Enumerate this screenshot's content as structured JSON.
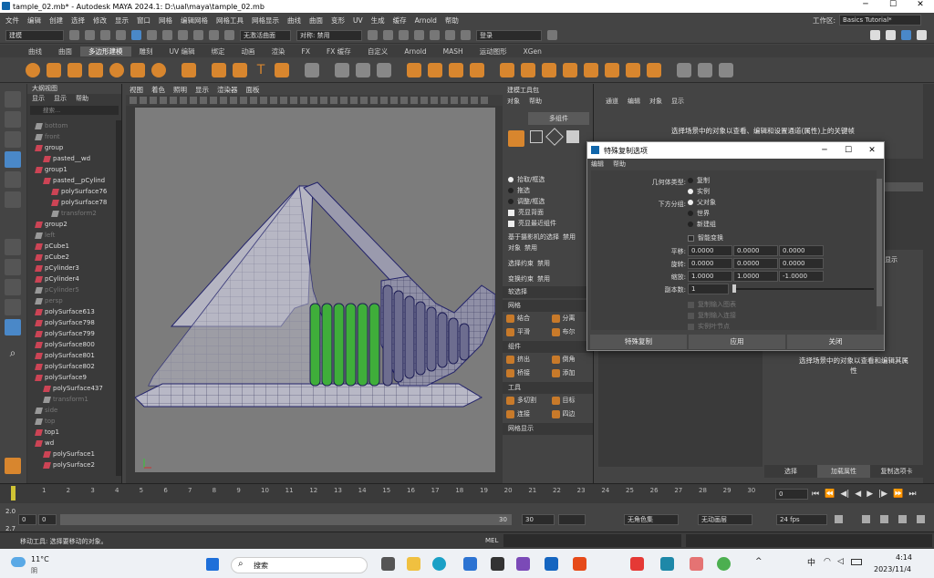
{
  "window": {
    "title": "tample_02.mb* - Autodesk MAYA 2024.1: D:\\ual\\maya\\tample_02.mb"
  },
  "menubar": {
    "items": [
      "文件",
      "编辑",
      "创建",
      "选择",
      "修改",
      "显示",
      "窗口",
      "网格",
      "编辑网格",
      "网格工具",
      "网格显示",
      "曲线",
      "曲面",
      "变形",
      "UV",
      "生成",
      "缓存",
      "Arnold",
      "帮助"
    ],
    "workspace_label": "工作区:",
    "workspace_value": "Basics Tutorial*"
  },
  "statusline": {
    "mode": "建模",
    "live_surface": "无激活曲面",
    "symmetry": "对称: 禁用",
    "login": "登录"
  },
  "shelf": {
    "tabs": [
      "曲线",
      "曲面",
      "多边形建模",
      "雕刻",
      "UV 编辑",
      "绑定",
      "动画",
      "渲染",
      "FX",
      "FX 缓存",
      "自定义",
      "Arnold",
      "MASH",
      "运动图形",
      "XGen"
    ],
    "active_tab": 2
  },
  "outliner": {
    "title": "大纲视图",
    "menu": [
      "显示",
      "显示",
      "帮助"
    ],
    "search_placeholder": "搜索...",
    "items": [
      {
        "label": "bottom",
        "dim": true,
        "indent": 1
      },
      {
        "label": "front",
        "dim": true,
        "indent": 1
      },
      {
        "label": "group",
        "dim": false,
        "indent": 1
      },
      {
        "label": "pasted__wd",
        "dim": false,
        "indent": 2
      },
      {
        "label": "group1",
        "dim": false,
        "indent": 1
      },
      {
        "label": "pasted__pCylind",
        "dim": false,
        "indent": 2
      },
      {
        "label": "polySurface76",
        "dim": false,
        "indent": 3
      },
      {
        "label": "polySurface78",
        "dim": false,
        "indent": 3
      },
      {
        "label": "transform2",
        "dim": true,
        "indent": 3
      },
      {
        "label": "group2",
        "dim": false,
        "indent": 1
      },
      {
        "label": "left",
        "dim": true,
        "indent": 1
      },
      {
        "label": "pCube1",
        "dim": false,
        "indent": 1
      },
      {
        "label": "pCube2",
        "dim": false,
        "indent": 1
      },
      {
        "label": "pCylinder3",
        "dim": false,
        "indent": 1
      },
      {
        "label": "pCylinder4",
        "dim": false,
        "indent": 1
      },
      {
        "label": "pCylinder5",
        "dim": true,
        "indent": 1
      },
      {
        "label": "persp",
        "dim": true,
        "indent": 1
      },
      {
        "label": "polySurface613",
        "dim": false,
        "indent": 1
      },
      {
        "label": "polySurface798",
        "dim": false,
        "indent": 1
      },
      {
        "label": "polySurface799",
        "dim": false,
        "indent": 1
      },
      {
        "label": "polySurface800",
        "dim": false,
        "indent": 1
      },
      {
        "label": "polySurface801",
        "dim": false,
        "indent": 1
      },
      {
        "label": "polySurface802",
        "dim": false,
        "indent": 1
      },
      {
        "label": "polySurface9",
        "dim": false,
        "indent": 1
      },
      {
        "label": "polySurface437",
        "dim": false,
        "indent": 2
      },
      {
        "label": "transform1",
        "dim": true,
        "indent": 2
      },
      {
        "label": "side",
        "dim": true,
        "indent": 1
      },
      {
        "label": "top",
        "dim": true,
        "indent": 1
      },
      {
        "label": "top1",
        "dim": false,
        "indent": 1
      },
      {
        "label": "wd",
        "dim": false,
        "indent": 1
      },
      {
        "label": "polySurface1",
        "dim": false,
        "indent": 2
      },
      {
        "label": "polySurface2",
        "dim": false,
        "indent": 2
      }
    ]
  },
  "viewport": {
    "menu": [
      "视图",
      "着色",
      "照明",
      "显示",
      "渲染器",
      "面板"
    ]
  },
  "modeling": {
    "title": "建模工具包",
    "menu": [
      "对象",
      "帮助"
    ],
    "multi": "多组件",
    "radios": [
      {
        "label": "拾取/框选",
        "on": true
      },
      {
        "label": "拖选",
        "on": false
      },
      {
        "label": "调整/框选",
        "on": false
      }
    ],
    "checks": [
      "亮显背面",
      "亮显最近组件"
    ],
    "sel_based": "基于摄影机的选择",
    "disabled": "禁用",
    "object": "对象",
    "constraint": "选择约束",
    "transform_constraint": "变换约束",
    "soft": "软选择",
    "mesh": "网格",
    "combine": "结合",
    "separate": "分离",
    "smooth": "平滑",
    "boolean": "布尔",
    "components": "组件",
    "extrude": "挤出",
    "bevel": "倒角",
    "bridge": "桥接",
    "add_div": "添加",
    "tools": "工具",
    "multicut": "多切割",
    "target": "目标",
    "connect": "连接",
    "quad": "四边",
    "more": "网格显示"
  },
  "channel": {
    "menu": [
      "通道",
      "编辑",
      "对象",
      "显示"
    ],
    "msg": "选择场景中的对象以查看、编辑和设置通道(属性)上的关键帧",
    "msg2": "选择场景中的对象以查看和编辑其属性",
    "tabs": [
      "选择",
      "加载属性",
      "复制选项卡"
    ],
    "show": "显示"
  },
  "dialog": {
    "title": "特殊复制选项",
    "menu": [
      "编辑",
      "帮助"
    ],
    "geom_label": "几何体类型:",
    "geom_opts": [
      {
        "label": "复制",
        "on": false
      },
      {
        "label": "实例",
        "on": true
      }
    ],
    "group_label": "下方分组:",
    "group_opts": [
      {
        "label": "父对象",
        "on": true
      },
      {
        "label": "世界",
        "on": false
      },
      {
        "label": "新建组",
        "on": false
      }
    ],
    "smart": "智能变换",
    "translate_label": "平移:",
    "translate": [
      "0.0000",
      "0.0000",
      "0.0000"
    ],
    "rotate_label": "旋转:",
    "rotate": [
      "0.0000",
      "0.0000",
      "0.0000"
    ],
    "scale_label": "缩放:",
    "scale": [
      "1.0000",
      "1.0000",
      "-1.0000"
    ],
    "copies_label": "副本数:",
    "copies": "1",
    "opt1": "复制输入图表",
    "opt2": "复制输入连接",
    "opt3": "实例叶节点",
    "btn_apply_close": "特殊复制",
    "btn_apply": "应用",
    "btn_close": "关闭"
  },
  "timeline": {
    "ticks": [
      "1",
      "2",
      "3",
      "4",
      "5",
      "6",
      "7",
      "8",
      "9",
      "10",
      "11",
      "12",
      "13",
      "14",
      "15",
      "16",
      "17",
      "18",
      "19",
      "20",
      "21",
      "22",
      "23",
      "24",
      "25",
      "26",
      "27",
      "28",
      "29",
      "30"
    ],
    "current": "0"
  },
  "range": {
    "start": "0",
    "start2": "0",
    "end": "30",
    "end2": "30",
    "char": "无角色集",
    "anim": "无动画层",
    "fps": "24 fps",
    "left1": "2.0",
    "left2": "2.7"
  },
  "cmd": {
    "mel": "MEL",
    "help": "移动工具: 选择要移动的对象。"
  },
  "taskbar": {
    "temp": "11°C",
    "weather": "阴",
    "search": "搜索",
    "time": "4:14",
    "date": "2023/11/4",
    "ime": "中"
  }
}
